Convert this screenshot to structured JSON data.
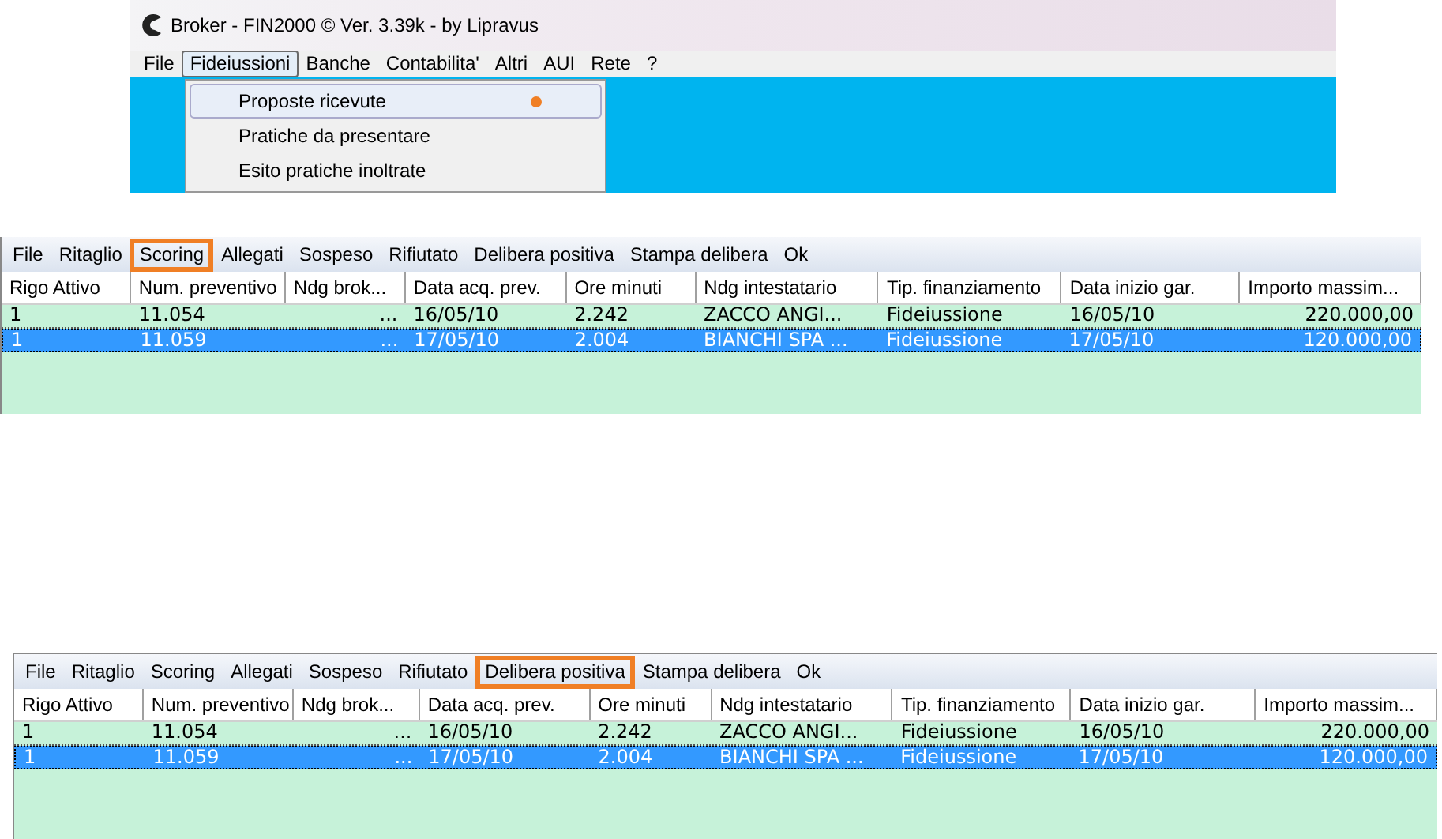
{
  "app_window": {
    "title": "Broker - FIN2000 © Ver.  3.39k - by Lipravus",
    "menu": [
      {
        "label": "File",
        "selected": false
      },
      {
        "label": "Fideiussioni",
        "selected": true
      },
      {
        "label": "Banche",
        "selected": false
      },
      {
        "label": "Contabilita'",
        "selected": false
      },
      {
        "label": "Altri",
        "selected": false
      },
      {
        "label": "AUI",
        "selected": false
      },
      {
        "label": "Rete",
        "selected": false
      },
      {
        "label": "?",
        "selected": false
      }
    ],
    "dropdown": [
      {
        "label": "Proposte ricevute",
        "selected": true
      },
      {
        "label": "Pratiche da presentare",
        "selected": false
      },
      {
        "label": "Esito pratiche inoltrate",
        "selected": false
      }
    ]
  },
  "panels": [
    {
      "toolbar": [
        {
          "label": "File",
          "selected": false
        },
        {
          "label": "Ritaglio",
          "selected": false
        },
        {
          "label": "Scoring",
          "selected": true
        },
        {
          "label": "Allegati",
          "selected": false
        },
        {
          "label": "Sospeso",
          "selected": false
        },
        {
          "label": "Rifiutato",
          "selected": false
        },
        {
          "label": "Delibera positiva",
          "selected": false
        },
        {
          "label": "Stampa delibera",
          "selected": false
        },
        {
          "label": "Ok",
          "selected": false
        }
      ],
      "columns": [
        "Rigo Attivo",
        "Num. preventivo",
        "Ndg brok...",
        "Data acq. prev.",
        "Ore minuti",
        "Ndg intestatario",
        "Tip. finanziamento",
        "Data inizio gar.",
        "Importo massim..."
      ],
      "rows": [
        {
          "selected": false,
          "cells": [
            "1",
            "11.054",
            "...",
            "16/05/10",
            "2.242",
            "ZACCO ANGI...",
            "Fideiussione",
            "16/05/10",
            "220.000,00"
          ]
        },
        {
          "selected": true,
          "cells": [
            "1",
            "11.059",
            "...",
            "17/05/10",
            "2.004",
            "BIANCHI SPA ...",
            "Fideiussione",
            "17/05/10",
            "120.000,00"
          ]
        }
      ]
    },
    {
      "toolbar": [
        {
          "label": "File",
          "selected": false
        },
        {
          "label": "Ritaglio",
          "selected": false
        },
        {
          "label": "Scoring",
          "selected": false
        },
        {
          "label": "Allegati",
          "selected": false
        },
        {
          "label": "Sospeso",
          "selected": false
        },
        {
          "label": "Rifiutato",
          "selected": false
        },
        {
          "label": "Delibera positiva",
          "selected": true
        },
        {
          "label": "Stampa delibera",
          "selected": false
        },
        {
          "label": "Ok",
          "selected": false
        }
      ],
      "columns": [
        "Rigo Attivo",
        "Num. preventivo",
        "Ndg brok...",
        "Data acq. prev.",
        "Ore minuti",
        "Ndg intestatario",
        "Tip. finanziamento",
        "Data inizio gar.",
        "Importo massim..."
      ],
      "rows": [
        {
          "selected": false,
          "cells": [
            "1",
            "11.054",
            "...",
            "16/05/10",
            "2.242",
            "ZACCO ANGI...",
            "Fideiussione",
            "16/05/10",
            "220.000,00"
          ]
        },
        {
          "selected": true,
          "cells": [
            "1",
            "11.059",
            "...",
            "17/05/10",
            "2.004",
            "BIANCHI SPA ...",
            "Fideiussione",
            "17/05/10",
            "120.000,00"
          ]
        }
      ]
    }
  ]
}
